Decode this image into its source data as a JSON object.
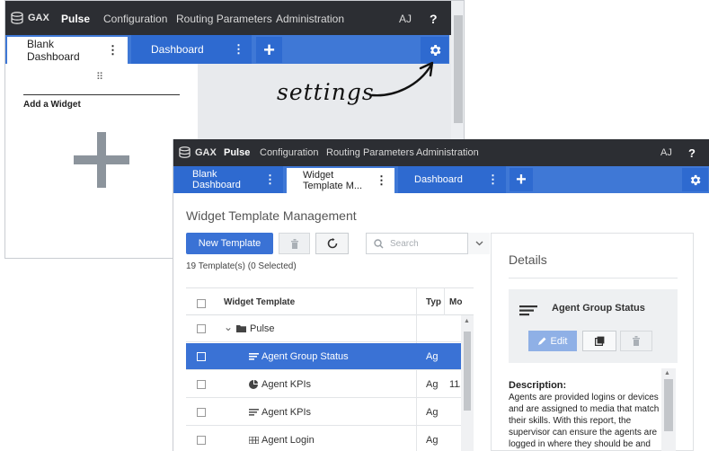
{
  "back": {
    "topbar": {
      "logo": "GAX",
      "nav": [
        "Pulse",
        "Configuration",
        "Routing Parameters",
        "Administration"
      ],
      "user": "AJ",
      "help": "?"
    },
    "tabs": [
      {
        "label": "Blank Dashboard",
        "menu": "⋮"
      },
      {
        "label": "Dashboard",
        "menu": "⋮"
      }
    ],
    "add_tab": "+",
    "widget_panel": {
      "drag_handle": "⠿",
      "title": "Add a Widget",
      "add_glyph": "+"
    }
  },
  "annotation": "settings",
  "front": {
    "topbar": {
      "logo": "GAX",
      "nav": [
        "Pulse",
        "Configuration",
        "Routing Parameters",
        "Administration"
      ],
      "user": "AJ",
      "help": "?"
    },
    "tabs": [
      {
        "label": "Blank Dashboard",
        "menu": "⋮"
      },
      {
        "label": "Widget Template M...",
        "menu": "⋮"
      },
      {
        "label": "Dashboard",
        "menu": "⋮"
      }
    ],
    "add_tab": "+",
    "page_title": "Widget Template Management",
    "toolbar": {
      "new_template": "New Template",
      "search_placeholder": "Search"
    },
    "count_text": "19 Template(s) (0 Selected)",
    "table": {
      "columns": [
        "Widget Template",
        "Typ",
        "Mo"
      ],
      "rows": [
        {
          "name": "Pulse",
          "type": "",
          "modified": "",
          "kind": "folder",
          "icon": "folder-icon",
          "expander": "⌄"
        },
        {
          "name": "Agent Group Status",
          "type": "Ag",
          "modified": "",
          "kind": "selected",
          "icon": "list-lines-icon"
        },
        {
          "name": "Agent KPIs",
          "type": "Ag",
          "modified": "11/",
          "kind": "item",
          "icon": "pie-icon"
        },
        {
          "name": "Agent KPIs",
          "type": "Ag",
          "modified": "",
          "kind": "item",
          "icon": "list-lines-icon"
        },
        {
          "name": "Agent Login",
          "type": "Ag",
          "modified": "",
          "kind": "item",
          "icon": "grid-icon"
        }
      ]
    },
    "details": {
      "title": "Details",
      "card_title": "Agent Group Status",
      "edit_label": "Edit",
      "description_heading": "Description:",
      "description": "Agents are provided logins or devices and are assigned to media that match their skills. With this report, the supervisor can ensure the agents are logged in where they should be and managing the media for which they are responsible."
    },
    "colors": {
      "accent": "#3a72d5",
      "topbar": "#2c2e33",
      "tab_dark": "#2e6ad0"
    }
  }
}
